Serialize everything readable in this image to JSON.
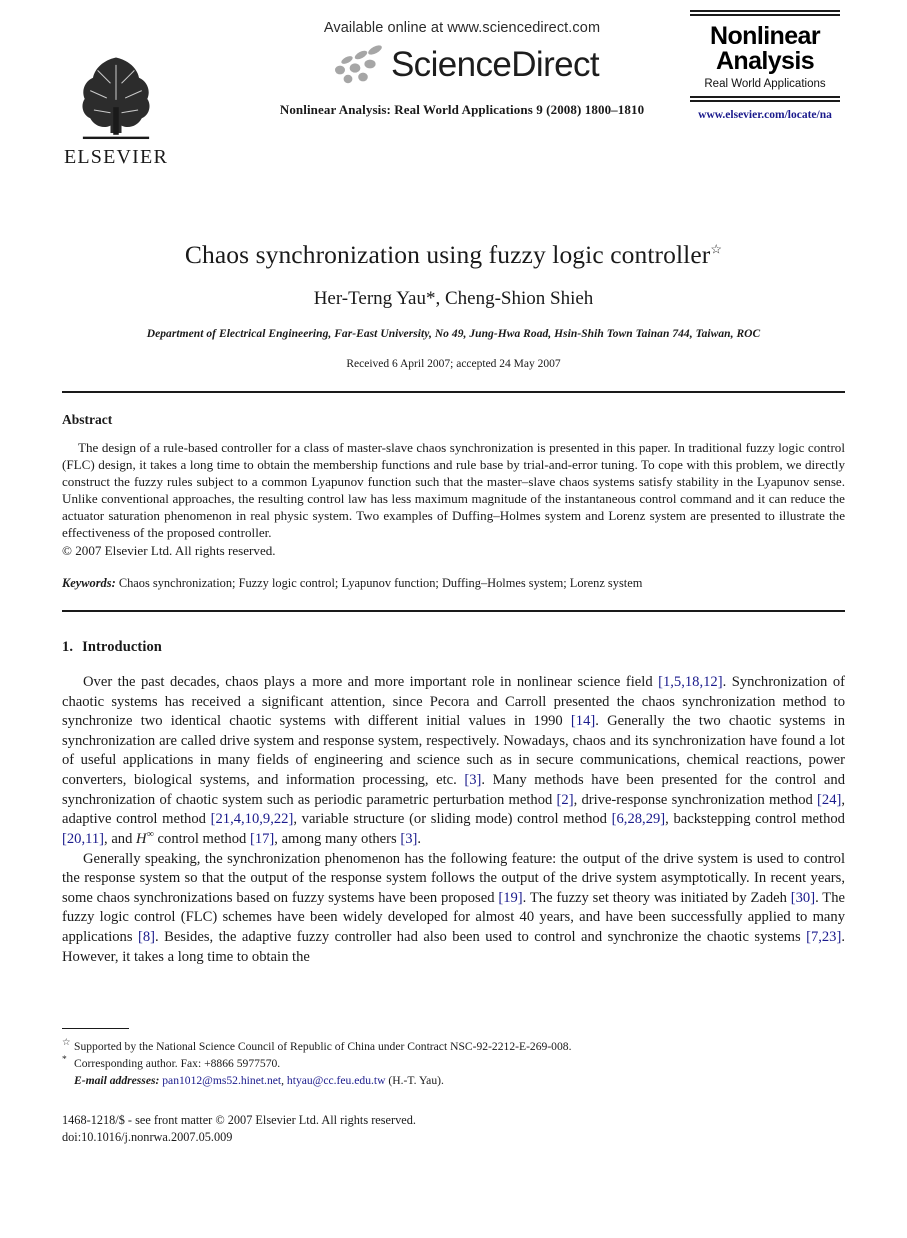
{
  "masthead": {
    "elsevier_wordmark": "ELSEVIER",
    "available_online": "Available online at www.sciencedirect.com",
    "sciencedirect_wordmark": "ScienceDirect",
    "journal_reference": "Nonlinear Analysis: Real World Applications 9 (2008) 1800–1810",
    "journal_logo_line1": "Nonlinear",
    "journal_logo_line2": "Analysis",
    "journal_logo_sub": "Real World Applications",
    "journal_url": "www.elsevier.com/locate/na"
  },
  "article": {
    "title": "Chaos synchronization using fuzzy logic controller",
    "title_footnote_mark": "☆",
    "authors": "Her-Terng Yau*, Cheng-Shion Shieh",
    "affiliation": "Department of Electrical Engineering, Far-East University, No 49, Jung-Hwa Road, Hsin-Shih Town Tainan 744, Taiwan, ROC",
    "received": "Received 6 April 2007; accepted 24 May 2007"
  },
  "abstract": {
    "heading": "Abstract",
    "text": "The design of a rule-based controller for a class of master-slave chaos synchronization is presented in this paper. In traditional fuzzy logic control (FLC) design, it takes a long time to obtain the membership functions and rule base by trial-and-error tuning. To cope with this problem, we directly construct the fuzzy rules subject to a common Lyapunov function such that the master–slave chaos systems satisfy stability in the Lyapunov sense. Unlike conventional approaches, the resulting control law has less maximum magnitude of the instantaneous control command and it can reduce the actuator saturation phenomenon in real physic system. Two examples of Duffing–Holmes system and Lorenz system are presented to illustrate the effectiveness of the proposed controller.",
    "copyright": "© 2007 Elsevier Ltd. All rights reserved.",
    "keywords_label": "Keywords:",
    "keywords": "Chaos synchronization; Fuzzy logic control; Lyapunov function; Duffing–Holmes system; Lorenz system"
  },
  "section1": {
    "number": "1.",
    "heading": "Introduction",
    "paragraph1_parts": [
      {
        "t": "Over the past decades, chaos plays a more and more important role in nonlinear science field ",
        "k": "text"
      },
      {
        "t": "[1,5,18,12]",
        "k": "cite"
      },
      {
        "t": ". Synchronization of chaotic systems has received a significant attention, since Pecora and Carroll presented the chaos synchronization method to synchronize two identical chaotic systems with different initial values in 1990 ",
        "k": "text"
      },
      {
        "t": "[14]",
        "k": "cite"
      },
      {
        "t": ". Generally the two chaotic systems in synchronization are called drive system and response system, respectively. Nowadays, chaos and its synchronization have found a lot of useful applications in many fields of engineering and science such as in secure communications, chemical reactions, power converters, biological systems, and information processing, etc. ",
        "k": "text"
      },
      {
        "t": "[3]",
        "k": "cite"
      },
      {
        "t": ". Many methods have been presented for the control and synchronization of chaotic system such as periodic parametric perturbation method ",
        "k": "text"
      },
      {
        "t": "[2]",
        "k": "cite"
      },
      {
        "t": ", drive-response synchronization method ",
        "k": "text"
      },
      {
        "t": "[24]",
        "k": "cite"
      },
      {
        "t": ", adaptive control method ",
        "k": "text"
      },
      {
        "t": "[21,4,10,9,22]",
        "k": "cite"
      },
      {
        "t": ", variable structure (or sliding mode) control method ",
        "k": "text"
      },
      {
        "t": "[6,28,29]",
        "k": "cite"
      },
      {
        "t": ", backstepping control method ",
        "k": "text"
      },
      {
        "t": "[20,11]",
        "k": "cite"
      },
      {
        "t": ", and ",
        "k": "text"
      },
      {
        "t": "H",
        "k": "math"
      },
      {
        "t": "∞",
        "k": "sup"
      },
      {
        "t": " control method ",
        "k": "text"
      },
      {
        "t": "[17]",
        "k": "cite"
      },
      {
        "t": ", among many others ",
        "k": "text"
      },
      {
        "t": "[3]",
        "k": "cite"
      },
      {
        "t": ".",
        "k": "text"
      }
    ],
    "paragraph2_parts": [
      {
        "t": "Generally speaking, the synchronization phenomenon has the following feature: the output of the drive system is used to control the response system so that the output of the response system follows the output of the drive system asymptotically. In recent years, some chaos synchronizations based on fuzzy systems have been proposed ",
        "k": "text"
      },
      {
        "t": "[19]",
        "k": "cite"
      },
      {
        "t": ". The fuzzy set theory was initiated by Zadeh ",
        "k": "text"
      },
      {
        "t": "[30]",
        "k": "cite"
      },
      {
        "t": ". The fuzzy logic control (FLC) schemes have been widely developed for almost 40 years, and have been successfully applied to many applications ",
        "k": "text"
      },
      {
        "t": "[8]",
        "k": "cite"
      },
      {
        "t": ". Besides, the adaptive fuzzy controller had also been used to control and synchronize the chaotic systems ",
        "k": "text"
      },
      {
        "t": "[7,23]",
        "k": "cite"
      },
      {
        "t": ". However, it takes a long time to obtain the",
        "k": "text"
      }
    ]
  },
  "footnotes": {
    "funding_mark": "☆",
    "funding": "Supported by the National Science Council of Republic of China under Contract NSC-92-2212-E-269-008.",
    "corresponding_mark": "*",
    "corresponding": "Corresponding author. Fax: +8866 5977570.",
    "email_label": "E-mail addresses:",
    "email1": "pan1012@ms52.hinet.net",
    "email_sep": ", ",
    "email2": "htyau@cc.feu.edu.tw",
    "email_suffix": " (H.-T. Yau)."
  },
  "imprint": {
    "line1": "1468-1218/$ - see front matter © 2007 Elsevier Ltd. All rights reserved.",
    "line2": "doi:10.1016/j.nonrwa.2007.05.009"
  },
  "colors": {
    "link": "#1a1a8c",
    "text": "#1a1a1a"
  }
}
